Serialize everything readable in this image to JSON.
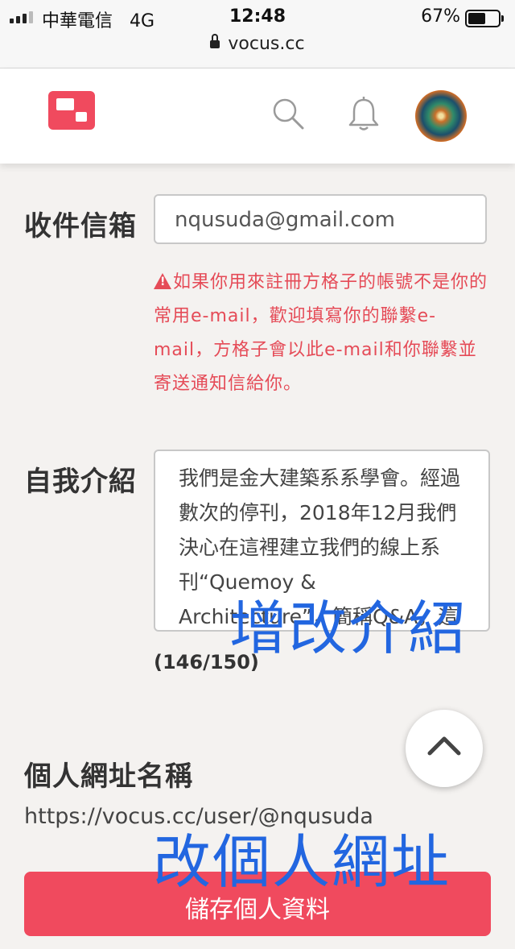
{
  "status_bar": {
    "carrier": "中華電信",
    "network": "4G",
    "time": "12:48",
    "battery": "67%",
    "battery_level": 0.67,
    "url": "vocus.cc",
    "icons": [
      "signal-icon",
      "lock-icon",
      "battery-icon"
    ]
  },
  "header": {
    "icons": [
      "vocus-logo",
      "search-icon",
      "bell-icon",
      "avatar"
    ],
    "brand_color": "#f04a5e"
  },
  "email_section": {
    "label": "收件信箱",
    "value": "nqusuda@gmail.com",
    "warning": "如果你用來註冊方格子的帳號不是你的常用e-mail，歡迎填寫你的聯繫e-mail，方格子會以此e-mail和你聯繫並寄送通知信給你。",
    "warning_color": "#e54b57"
  },
  "bio_section": {
    "label": "自我介紹",
    "text": "我們是金大建築系系學會。經過數次的停刊，2018年12月我們決心在這裡建立我們的線上系刊“Quemoy & Architecture”，簡稱Q&A，這份系刊主要紀錄系上的點滴。",
    "counter": "(146/150)"
  },
  "url_section": {
    "label": "個人網址名稱",
    "value": "https://vocus.cc/user/@nqusuda"
  },
  "save_button": {
    "label": "儲存個人資料"
  },
  "annotations": {
    "bio": "增改介紹",
    "url": "改個人網址",
    "color": "#2266e0"
  },
  "scroll_top_icon": "chevron-up-icon"
}
